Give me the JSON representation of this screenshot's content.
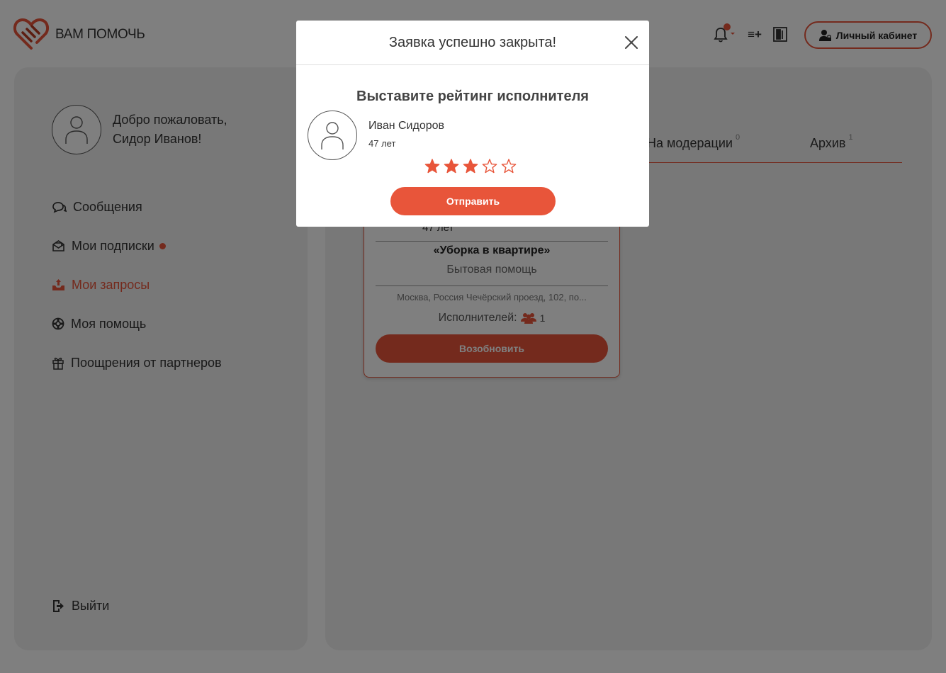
{
  "colors": {
    "accent": "#e8553a",
    "panel": "#f0f0f0",
    "overlay": "rgba(0,0,0,0.5)"
  },
  "header": {
    "logo_text": "ВАМ ПОМОЧЬ",
    "icons": [
      "bell-icon",
      "list-add-icon",
      "book-icon"
    ],
    "notification_badge": true,
    "cabinet_button": "Личный кабинет"
  },
  "sidebar": {
    "welcome_line1": "Добро пожаловать,",
    "welcome_line2": "Сидор Иванов!",
    "nav": [
      {
        "label": "Сообщения",
        "icon": "chat-icon",
        "active": false,
        "dot": false
      },
      {
        "label": "Мои подписки",
        "icon": "envelope-icon",
        "active": false,
        "dot": true
      },
      {
        "label": "Мои запросы",
        "icon": "outbox-icon",
        "active": true,
        "dot": false
      },
      {
        "label": "Моя помощь",
        "icon": "lifebuoy-icon",
        "active": false,
        "dot": false
      },
      {
        "label": "Поощрения от партнеров",
        "icon": "gift-icon",
        "active": false,
        "dot": false
      }
    ],
    "logout": "Выйти"
  },
  "main": {
    "tabs": [
      {
        "label": "На модерации",
        "count": "0"
      },
      {
        "label": "Архив",
        "count": "1"
      }
    ],
    "card": {
      "age": "47 лет",
      "title": "«Уборка в квартире»",
      "category": "Бытовая помощь",
      "address": "Москва, Россия Чечёрский проезд, 102, по...",
      "executors_label": "Исполнителей:",
      "executors_count": "1",
      "renew_button": "Возобновить"
    }
  },
  "modal": {
    "title": "Заявка успешно закрыта!",
    "subtitle": "Выставите рейтинг исполнителя",
    "executor_name": "Иван Сидоров",
    "executor_age": "47 лет",
    "rating": 3,
    "rating_max": 5,
    "submit_button": "Отправить"
  }
}
